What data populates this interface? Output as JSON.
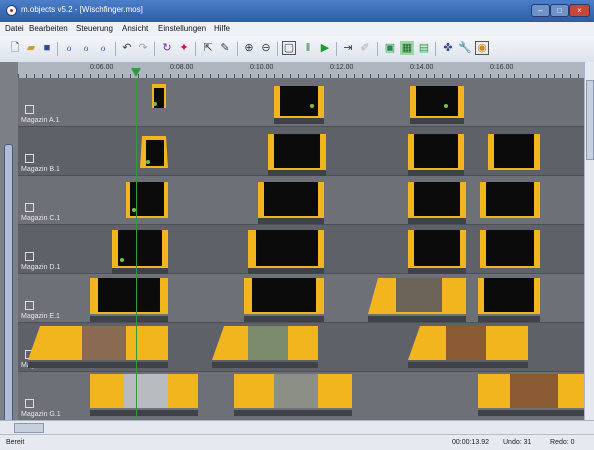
{
  "window": {
    "title": "m.objects v5.2 - [Wischfinger.mos]",
    "controls": [
      "min-icon",
      "max-icon",
      "close-icon"
    ]
  },
  "menu": [
    "Datei",
    "Bearbeiten",
    "Steuerung",
    "Ansicht",
    "Einstellungen",
    "Hilfe"
  ],
  "toolbar": [
    "new-file-icon",
    "open-folder-icon",
    "save-icon",
    "track-tool-icon",
    "track-tool-2-icon",
    "track-tool-3-icon",
    "undo-icon",
    "redo-icon",
    "refresh-icon",
    "wand-icon",
    "pointer-icon",
    "pencil-icon",
    "zoom-in-icon",
    "zoom-out-icon",
    "preview-window-icon",
    "pause-icon",
    "play-icon",
    "skip-icon",
    "pen-icon",
    "layout-icon",
    "grid-icon",
    "picture-icon",
    "sparkle-icon",
    "wrench-icon",
    "record-icon"
  ],
  "ruler": {
    "time_labels": [
      "0:06.00",
      "0:08.00",
      "0:10.00",
      "0:12.00",
      "0:14.00",
      "0:16.00"
    ]
  },
  "tracks": [
    {
      "num": "A",
      "label": "Magazin A.1"
    },
    {
      "num": "B",
      "label": "Magazin B.1"
    },
    {
      "num": "C",
      "label": "Magazin C.1"
    },
    {
      "num": "D",
      "label": "Magazin D.1"
    },
    {
      "num": "E",
      "label": "Magazin E.1"
    },
    {
      "num": "F",
      "label": "Mag"
    },
    {
      "num": "G",
      "label": "Magazin G.1"
    }
  ],
  "colors": {
    "clip_yellow": "#f2b51e",
    "clip_black": "#0b0b0b",
    "playhead": "#2f9b3c",
    "track_bg": "#6d7076"
  },
  "status": {
    "ready": "Bereit",
    "time": "00:00:13.92",
    "undo": "Undo: 31",
    "redo": "Redo: 0"
  }
}
